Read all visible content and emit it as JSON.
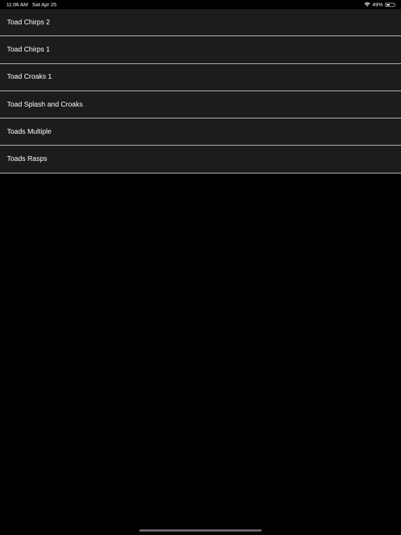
{
  "status_bar": {
    "time": "11:06 AM",
    "date": "Sat Apr 25",
    "battery_percent_label": "49%",
    "battery_level": 0.49,
    "wifi_icon": "wifi-icon",
    "battery_icon": "battery-icon"
  },
  "list": {
    "items": [
      {
        "label": "Toad Chirps 2"
      },
      {
        "label": "Toad Chirps 1"
      },
      {
        "label": "Toad Croaks 1"
      },
      {
        "label": "Toad Splash and Croaks"
      },
      {
        "label": "Toads Multiple"
      },
      {
        "label": "Toads Rasps"
      }
    ]
  },
  "colors": {
    "background": "#000000",
    "row_background": "#1c1c1e",
    "separator": "#c6c6c8",
    "text": "#ffffff",
    "home_indicator": "#6e6e73"
  }
}
